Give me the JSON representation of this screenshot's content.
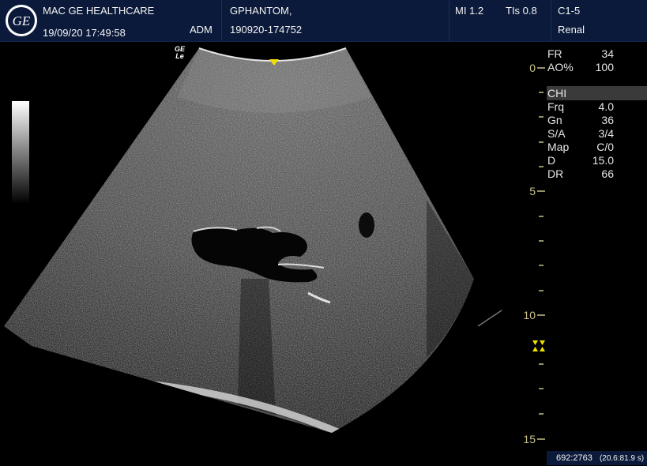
{
  "header": {
    "institution": "MAC GE HEALTHCARE",
    "datetime": "19/09/20 17:49:58",
    "operator": "ADM",
    "patient_name": "GPHANTOM,",
    "patient_id": "190920-174752",
    "mi": "MI 1.2",
    "tis": "TIs 0.8",
    "probe": "C1-5",
    "preset": "Renal"
  },
  "probe_badge": {
    "line1": "GE",
    "line2": "Le"
  },
  "params": {
    "fr_label": "FR",
    "fr_value": "34",
    "ao_label": "AO%",
    "ao_value": "100",
    "mode": "CHI",
    "frq_label": "Frq",
    "frq_value": "4.0",
    "gn_label": "Gn",
    "gn_value": "36",
    "sa_label": "S/A",
    "sa_value": "3/4",
    "map_label": "Map",
    "map_value": "C/0",
    "d_label": "D",
    "d_value": "15.0",
    "dr_label": "DR",
    "dr_value": "66"
  },
  "depth_scale": {
    "d0": "0",
    "d5": "5",
    "d10": "10",
    "d15": "15"
  },
  "footer": {
    "counter": "692:2763",
    "time": "(20.6:81.9 s)"
  },
  "colors": {
    "header_bg": "#0b1a3a",
    "depth_scale": "#c8c08a",
    "focus_marker": "#f0e000"
  }
}
